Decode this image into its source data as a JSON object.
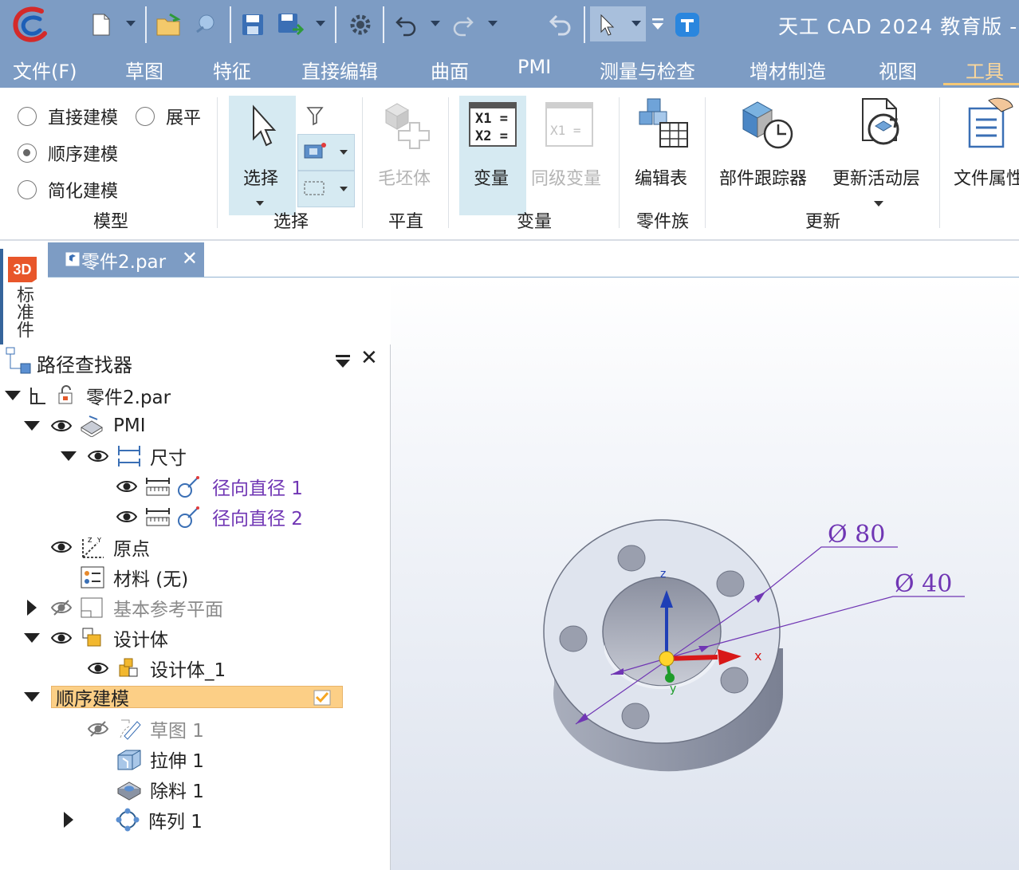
{
  "title_bar": {
    "app_title": "天工 CAD 2024 教育版 - |"
  },
  "menu": {
    "items": [
      "文件(F)",
      "草图",
      "特征",
      "直接编辑",
      "曲面",
      "PMI",
      "测量与检查",
      "增材制造",
      "视图",
      "工具"
    ],
    "active": "工具"
  },
  "ribbon": {
    "model_group": {
      "radios": [
        {
          "label": "直接建模",
          "selected": false
        },
        {
          "label": "展平",
          "selected": false
        },
        {
          "label": "顺序建模",
          "selected": true
        },
        {
          "label": "简化建模",
          "selected": false
        }
      ],
      "label": "模型"
    },
    "select_group": {
      "button": "选择",
      "label": "选择"
    },
    "plane_group": {
      "button": "毛坯体",
      "label": "平直"
    },
    "variable_group": {
      "button": "变量",
      "button2": "同级变量",
      "label": "变量",
      "icon_text1": "X1 =",
      "icon_text2": "X2 =",
      "icon_text3": "X1 ="
    },
    "family_group": {
      "button": "编辑表",
      "label": "零件族"
    },
    "update_group": {
      "button1": "部件跟踪器",
      "button2": "更新活动层",
      "label": "更新"
    },
    "file_group": {
      "button": "文件属性"
    }
  },
  "document": {
    "tab_label": "零件2.par",
    "side_tab": "标准件"
  },
  "path_finder": {
    "title": "路径查找器",
    "nodes": {
      "root": "零件2.par",
      "pmi": "PMI",
      "dimensions": "尺寸",
      "dim1": "径向直径 1",
      "dim2": "径向直径 2",
      "origin": "原点",
      "material": "材料 (无)",
      "base_planes": "基本参考平面",
      "design_bodies": "设计体",
      "design_body_1": "设计体_1",
      "sequential": "顺序建模",
      "sketch1": "草图 1",
      "extrude1": "拉伸 1",
      "cutout1": "除料 1",
      "pattern1": "阵列 1"
    }
  },
  "viewport": {
    "dim_outer": "Ø 80",
    "dim_inner": "Ø 40",
    "axis_z": "z",
    "axis_x": "x",
    "axis_y": "y"
  },
  "colors": {
    "title_bg": "#7d9cc4",
    "accent": "#f5c876",
    "dimension": "#7036b4",
    "selected_node": "#fccf86"
  }
}
